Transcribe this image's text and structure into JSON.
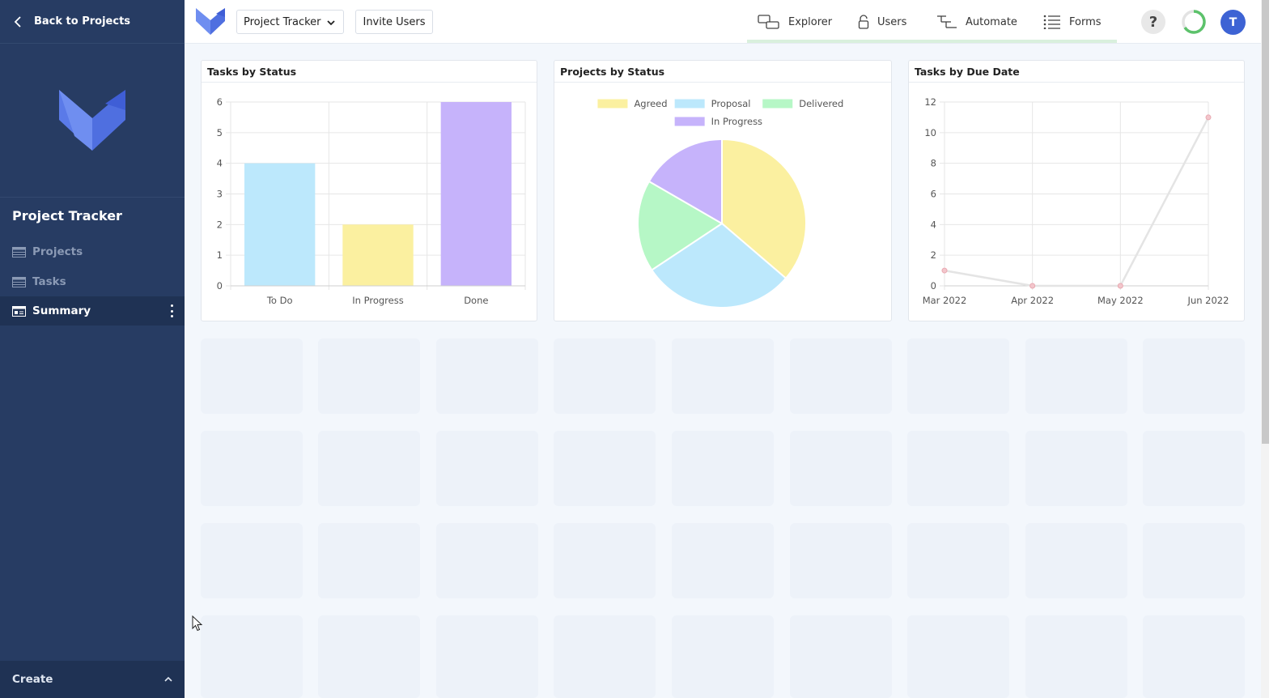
{
  "sidebar": {
    "back_label": "Back to Projects",
    "app_name": "Project Tracker",
    "items": [
      {
        "label": "Projects",
        "active": false
      },
      {
        "label": "Tasks",
        "active": false
      },
      {
        "label": "Summary",
        "active": true
      }
    ],
    "create_label": "Create"
  },
  "topbar": {
    "project_select": "Project Tracker",
    "invite_label": "Invite Users",
    "nav": [
      {
        "label": "Explorer",
        "icon": "explorer-icon"
      },
      {
        "label": "Users",
        "icon": "lock-icon"
      },
      {
        "label": "Automate",
        "icon": "automate-icon"
      },
      {
        "label": "Forms",
        "icon": "forms-icon"
      }
    ],
    "help_label": "?",
    "avatar_initial": "T"
  },
  "colors": {
    "sidebar_bg": "#273c63",
    "accent": "#3d63d4",
    "yellow": "#fbf0a0",
    "blue": "#bce8fc",
    "green": "#b6f7c6",
    "purple": "#c6b3fb"
  },
  "chart_data": [
    {
      "type": "bar",
      "title": "Tasks by Status",
      "categories": [
        "To Do",
        "In Progress",
        "Done"
      ],
      "values": [
        4,
        2,
        6
      ],
      "colors": [
        "#bce8fc",
        "#fbf0a0",
        "#c6b3fb"
      ],
      "ylim": [
        0,
        6
      ],
      "yticks": [
        0,
        1,
        2,
        3,
        4,
        5,
        6
      ],
      "grid": true
    },
    {
      "type": "pie",
      "title": "Projects by Status",
      "labels": [
        "Agreed",
        "Proposal",
        "Delivered",
        "In Progress"
      ],
      "values": [
        3.7,
        3,
        1.8,
        1.7
      ],
      "colors": [
        "#fbf0a0",
        "#bce8fc",
        "#b6f7c6",
        "#c6b3fb"
      ],
      "legend": "top"
    },
    {
      "type": "line",
      "title": "Tasks by Due Date",
      "x": [
        "Mar 2022",
        "Apr 2022",
        "May 2022",
        "Jun 2022"
      ],
      "values": [
        1,
        0,
        0,
        11
      ],
      "ylim": [
        0,
        12
      ],
      "yticks": [
        0,
        2,
        4,
        6,
        8,
        10,
        12
      ],
      "grid": true
    }
  ]
}
